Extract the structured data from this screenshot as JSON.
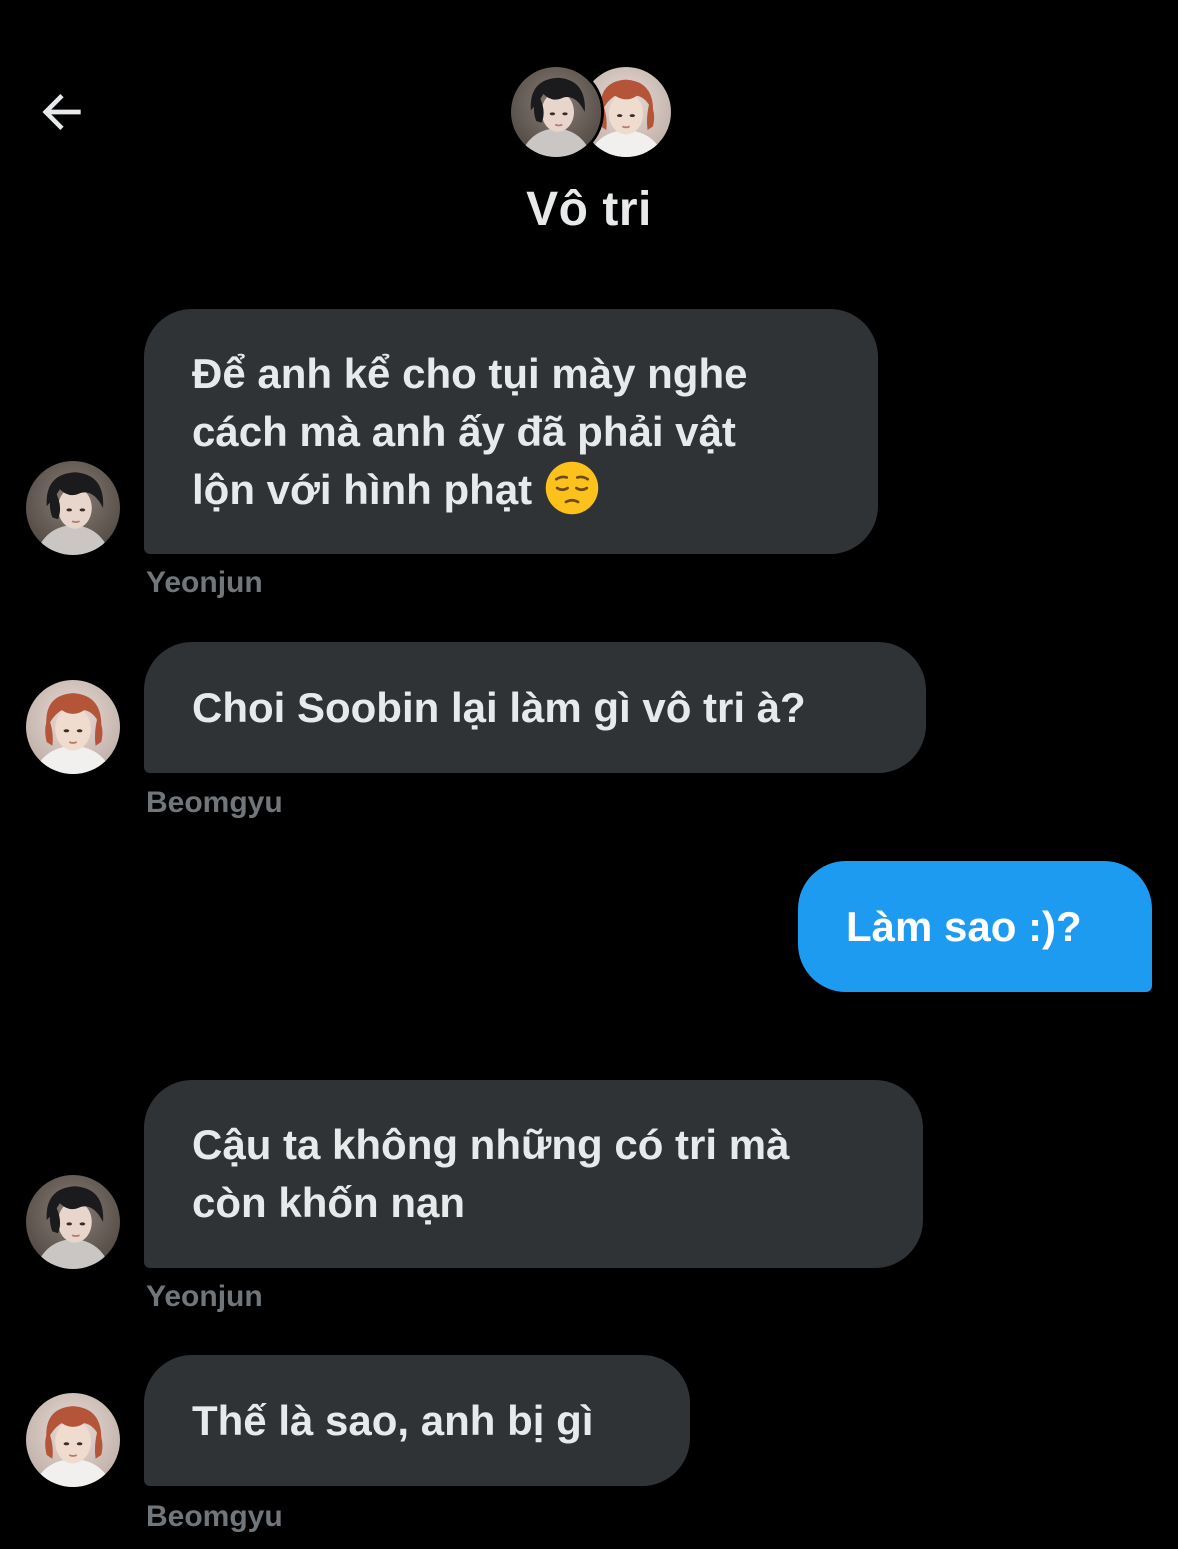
{
  "header": {
    "back_icon": "arrow-left-icon",
    "title": "Vô tri",
    "group_avatars": [
      "dark-hair-avatar",
      "red-hair-avatar"
    ]
  },
  "colors": {
    "background": "#000000",
    "received_bubble": "#2f3336",
    "sent_bubble": "#1d9bf0",
    "text_primary": "#e7e9ea",
    "text_secondary": "#71767b"
  },
  "messages": [
    {
      "direction": "received",
      "sender": "Yeonjun",
      "avatar": "dark-hair-avatar",
      "lines": [
        "Để anh kể cho tụi mày nghe",
        "cách mà anh ấy đã phải vật",
        "lộn với hình phạt"
      ],
      "emoji": "pensive-face-emoji"
    },
    {
      "direction": "received",
      "sender": "Beomgyu",
      "avatar": "red-hair-avatar",
      "lines": [
        "Choi Soobin lại làm gì vô tri à?"
      ]
    },
    {
      "direction": "sent",
      "lines": [
        "Làm sao :)?"
      ]
    },
    {
      "direction": "received",
      "sender": "Yeonjun",
      "avatar": "dark-hair-avatar",
      "lines": [
        "Cậu ta không những có tri mà",
        "còn khốn nạn"
      ]
    },
    {
      "direction": "received",
      "sender": "Beomgyu",
      "avatar": "red-hair-avatar",
      "lines": [
        "Thế là sao, anh bị gì"
      ]
    }
  ]
}
